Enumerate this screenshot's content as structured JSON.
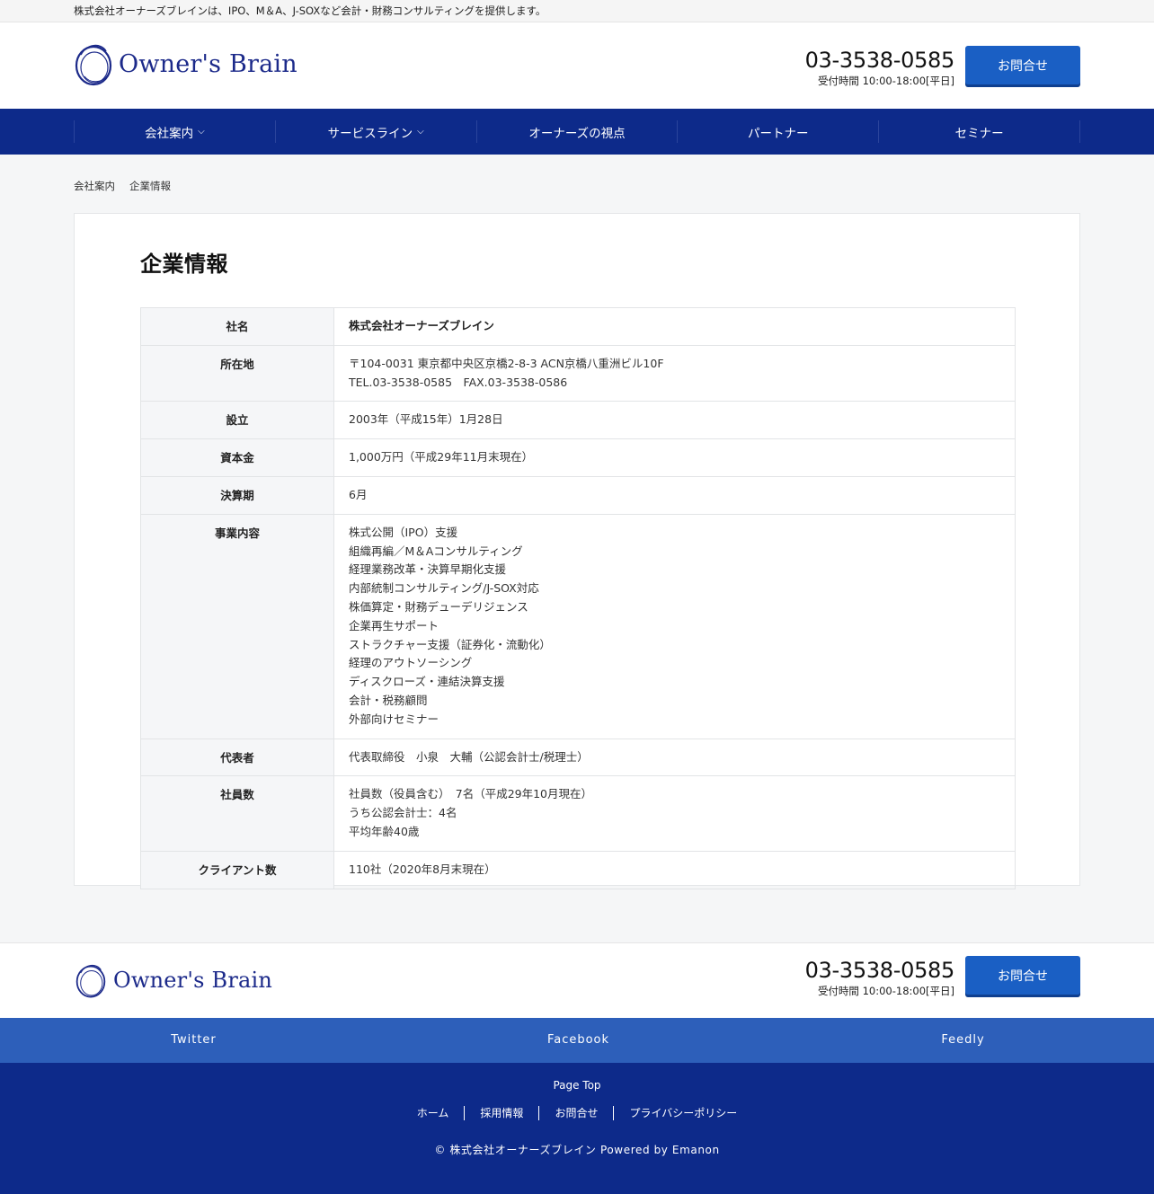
{
  "topbar": {
    "notice": "株式会社オーナーズブレインは、IPO、M＆A、J-SOXなど会計・財務コンサルティングを提供します。"
  },
  "header": {
    "logo_text": "Owner's Brain",
    "tel": "03-3538-0585",
    "tel_hours": "受付時間 10:00-18:00[平日]",
    "contact_button": "お問合せ",
    "phone_icon": "",
    "phone_icon_name": "phone-icon"
  },
  "nav": {
    "items": [
      {
        "label": "会社案内",
        "chevron": "⌵"
      },
      {
        "label": "サービスライン",
        "chevron": "⌵"
      },
      {
        "label": "オーナーズの視点",
        "chevron": ""
      },
      {
        "label": "パートナー",
        "chevron": ""
      },
      {
        "label": "セミナー",
        "chevron": ""
      }
    ]
  },
  "breadcrumb": {
    "parent": "会社案内",
    "separator": "",
    "current": "企業情報"
  },
  "main": {
    "title": "企業情報",
    "rows": [
      {
        "label": "社名",
        "lines": [
          "株式会社オーナーズブレイン"
        ]
      },
      {
        "label": "所在地",
        "lines": [
          "〒104-0031 東京都中央区京橋2-8-3 ACN京橋八重洲ビル10F",
          "TEL.03-3538-0585　FAX.03-3538-0586"
        ]
      },
      {
        "label": "設立",
        "lines": [
          "2003年（平成15年）1月28日"
        ]
      },
      {
        "label": "資本金",
        "lines": [
          "1,000万円（平成29年11月末現在）"
        ]
      },
      {
        "label": "決算期",
        "lines": [
          "6月"
        ]
      },
      {
        "label": "事業内容",
        "lines": [
          "株式公開（IPO）支援",
          "組織再編／M＆Aコンサルティング",
          "経理業務改革・決算早期化支援",
          "内部統制コンサルティング/J-SOX対応",
          "株価算定・財務デューデリジェンス",
          "企業再生サポート",
          "ストラクチャー支援（証券化・流動化）",
          "経理のアウトソーシング",
          "ディスクローズ・連結決算支援",
          "会計・税務顧問",
          "外部向けセミナー"
        ]
      },
      {
        "label": "代表者",
        "lines": [
          "代表取締役　小泉　大輔（公認会計士/税理士）"
        ]
      },
      {
        "label": "社員数",
        "lines": [
          "社員数（役員含む）　7名（平成29年10月現在）",
          "うち公認会計士：4名",
          "平均年齢40歳"
        ]
      },
      {
        "label": "クライアント数",
        "lines": [
          "110社（2020年8月末現在）"
        ]
      }
    ]
  },
  "footer_contact": {
    "logo_text": "Owner's Brain",
    "tel": "03-3538-0585",
    "tel_hours": "受付時間 10:00-18:00[平日]",
    "contact_button": "お問合せ"
  },
  "social": {
    "items": [
      {
        "label": "Twitter",
        "icon": ""
      },
      {
        "label": "Facebook",
        "icon": ""
      },
      {
        "label": "Feedly",
        "icon": ""
      }
    ]
  },
  "footer": {
    "pagetop_icon": "",
    "pagetop_label": "Page Top",
    "links": [
      "ホーム",
      "採用情報",
      "お問合せ",
      "プライバシーポリシー"
    ],
    "copyright": "© 株式会社オーナーズブレイン Powered by Emanon"
  },
  "colors": {
    "nav_bg": "#0d2a8a",
    "accent_button": "#1a5fc4",
    "social_bg": "#2d5fba",
    "logo_text": "#1c2a8a"
  }
}
